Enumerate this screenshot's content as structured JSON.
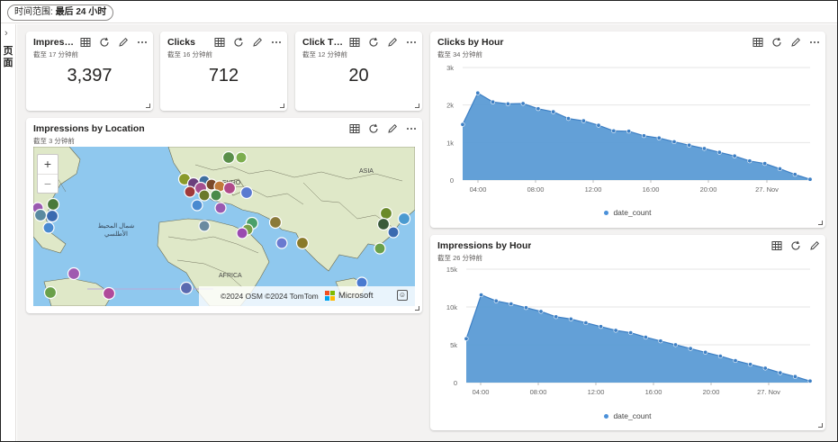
{
  "toolbar": {
    "time_range_label": "时间范围: ",
    "time_range_value": "最后 24 小时"
  },
  "sidebar": {
    "label": "页面"
  },
  "icons": {
    "grid": "table-icon",
    "refresh": "refresh-icon",
    "edit": "pencil-icon",
    "more": "more-icon"
  },
  "tiles": {
    "impressions": {
      "title": "Impressi...",
      "subtitle": "截至 17 分钟前",
      "value": "3,397"
    },
    "clicks": {
      "title": "Clicks",
      "subtitle": "截至 16 分钟前",
      "value": "712"
    },
    "ctr": {
      "title": "Click Thr...",
      "subtitle": "截至 12 分钟前",
      "value": "20"
    },
    "location": {
      "title": "Impressions by Location",
      "subtitle": "截至 3 分钟前",
      "map": {
        "zoom_in": "+",
        "zoom_out": "−",
        "labels": {
          "ocean": "شمال المحيط الأطلسي",
          "asia": "ASIA",
          "africa": "AFRICA",
          "europe": "EURO"
        },
        "attribution": "©2024 OSM ©2024 TomTom",
        "brand": "Microsoft"
      }
    },
    "clicks_by_hour": {
      "title": "Clicks by Hour",
      "subtitle": "截至 34 分钟前"
    },
    "impressions_by_hour": {
      "title": "Impressions by Hour",
      "subtitle": "截至 26 分钟前"
    }
  },
  "colors": {
    "area": "#5b9bd5",
    "line": "#3d7fc4",
    "grid": "#e6e6e6",
    "map_water": "#8fc8ee",
    "map_land": "#dfe8c8"
  },
  "chart_data": [
    {
      "type": "area",
      "id": "clicks_by_hour",
      "x_ticks": [
        "04:00",
        "08:00",
        "12:00",
        "16:00",
        "20:00",
        "27. Nov"
      ],
      "y_ticks": [
        "0",
        "1k",
        "2k",
        "3k"
      ],
      "ylim": [
        0,
        3000
      ],
      "series": [
        {
          "name": "date_count",
          "values": [
            1480,
            2320,
            2080,
            2030,
            2040,
            1900,
            1820,
            1640,
            1580,
            1460,
            1310,
            1300,
            1180,
            1120,
            1020,
            930,
            840,
            740,
            640,
            510,
            440,
            300,
            150,
            20
          ]
        }
      ]
    },
    {
      "type": "area",
      "id": "impressions_by_hour",
      "x_ticks": [
        "04:00",
        "08:00",
        "12:00",
        "16:00",
        "20:00",
        "27. Nov"
      ],
      "y_ticks": [
        "0",
        "5k",
        "10k",
        "15k"
      ],
      "ylim": [
        0,
        15000
      ],
      "series": [
        {
          "name": "date_count",
          "values": [
            5800,
            11600,
            10800,
            10400,
            9900,
            9400,
            8700,
            8400,
            7900,
            7400,
            6900,
            6600,
            6000,
            5500,
            5000,
            4500,
            4000,
            3500,
            2900,
            2400,
            1900,
            1300,
            800,
            200
          ]
        }
      ]
    }
  ]
}
